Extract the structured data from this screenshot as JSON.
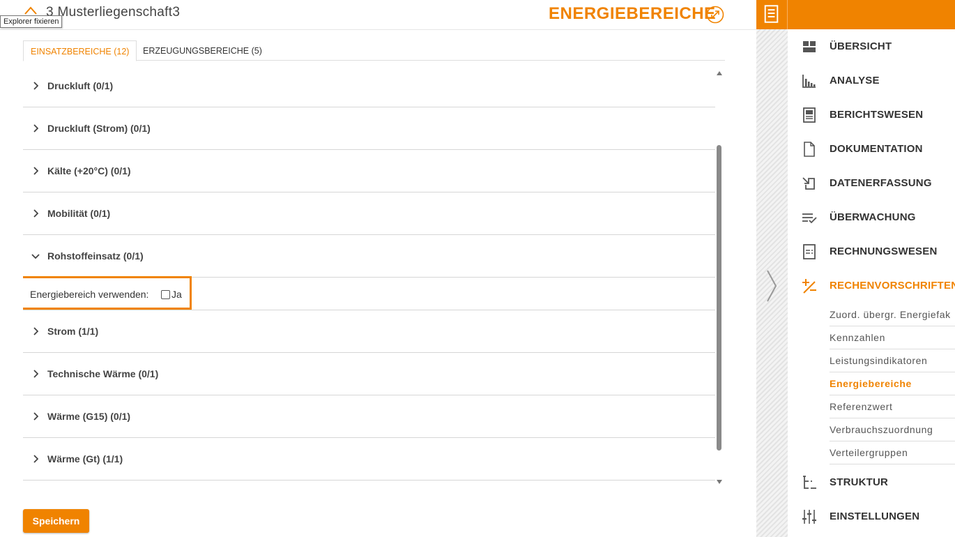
{
  "header": {
    "page_title": "3 Musterliegenschaft3",
    "section_title": "ENERGIEBEREICHE",
    "tooltip": "Explorer fixieren"
  },
  "tabs": [
    {
      "label": "EINSATZBEREICHE (12)",
      "active": true
    },
    {
      "label": "ERZEUGUNGSBEREICHE (5)",
      "active": false
    }
  ],
  "accordion": {
    "items": [
      {
        "label": "Druckluft (0/1)"
      },
      {
        "label": "Druckluft (Strom) (0/1)"
      },
      {
        "label": "Kälte (+20°C) (0/1)"
      },
      {
        "label": "Mobilität (0/1)"
      },
      {
        "label": "Rohstoffeinsatz (0/1)",
        "expanded": true
      },
      {
        "label": "Strom (1/1)"
      },
      {
        "label": "Technische Wärme (0/1)"
      },
      {
        "label": "Wärme (G15) (0/1)"
      },
      {
        "label": "Wärme (Gt) (1/1)"
      }
    ],
    "panel": {
      "field_label": "Energiebereich verwenden:",
      "checkbox_label": "Ja",
      "checked": false
    }
  },
  "save_label": "Speichern",
  "sidebar": {
    "items": [
      {
        "label": "ÜBERSICHT",
        "icon": "dashboard-icon"
      },
      {
        "label": "ANALYSE",
        "icon": "bar-chart-icon"
      },
      {
        "label": "BERICHTSWESEN",
        "icon": "report-icon"
      },
      {
        "label": "DOKUMENTATION",
        "icon": "document-icon"
      },
      {
        "label": "DATENERFASSUNG",
        "icon": "data-entry-icon"
      },
      {
        "label": "ÜBERWACHUNG",
        "icon": "checklist-icon"
      },
      {
        "label": "RECHNUNGSWESEN",
        "icon": "invoice-icon"
      },
      {
        "label": "RECHENVORSCHRIFTEN",
        "icon": "plus-minus-icon",
        "active": true
      },
      {
        "label": "STRUKTUR",
        "icon": "tree-structure-icon"
      },
      {
        "label": "EINSTELLUNGEN",
        "icon": "sliders-icon"
      }
    ],
    "subitems": [
      {
        "label": "Zuord. übergr. Energiefak"
      },
      {
        "label": "Kennzahlen"
      },
      {
        "label": "Leistungsindikatoren"
      },
      {
        "label": "Energiebereiche",
        "active": true
      },
      {
        "label": "Referenzwert"
      },
      {
        "label": "Verbrauchszuordnung"
      },
      {
        "label": "Verteilergruppen"
      }
    ]
  },
  "colors": {
    "accent": "#f08300",
    "text": "#333333",
    "divider": "#d6d6d6"
  }
}
